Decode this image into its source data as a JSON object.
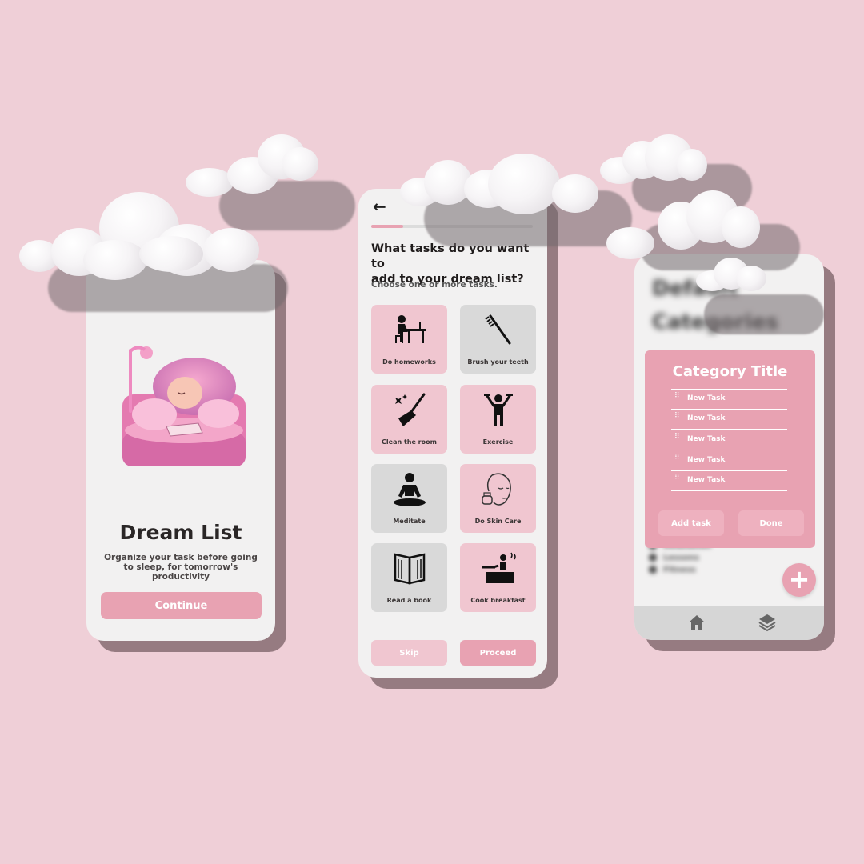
{
  "screen1": {
    "title": "Dream List",
    "subtitle_line1": "Organize your task before going",
    "subtitle_line2": "to sleep, for tomorrow's productivity",
    "continue_label": "Continue"
  },
  "screen2": {
    "back_icon": "arrow-left-icon",
    "progress": 0.2,
    "question_line1": "What tasks do you want to",
    "question_line2": "add to your dream list?",
    "hint": "Choose one or more tasks.",
    "tasks": [
      {
        "label": "Do homeworks",
        "icon": "homework-desk-icon",
        "selected": true
      },
      {
        "label": "Brush your teeth",
        "icon": "toothbrush-icon",
        "selected": false
      },
      {
        "label": "Clean the room",
        "icon": "broom-icon",
        "selected": true
      },
      {
        "label": "Exercise",
        "icon": "exercise-person-icon",
        "selected": true
      },
      {
        "label": "Meditate",
        "icon": "meditate-icon",
        "selected": false
      },
      {
        "label": "Do Skin Care",
        "icon": "skin-care-face-icon",
        "selected": true
      },
      {
        "label": "Read a book",
        "icon": "open-book-icon",
        "selected": false
      },
      {
        "label": "Cook breakfast",
        "icon": "cooking-icon",
        "selected": true
      }
    ],
    "skip_label": "Skip",
    "proceed_label": "Proceed",
    "colors": {
      "selected": "#f0c6d0",
      "unselected": "#d9d9d9",
      "accent": "#e8a2b2"
    }
  },
  "screen3": {
    "background_title_line1": "Default",
    "background_title_line2": "Categories",
    "background_list": [
      "Relaxation",
      "Lessons",
      "Fitness"
    ],
    "modal": {
      "title": "Category Title",
      "items": [
        "New Task",
        "New Task",
        "New Task",
        "New Task",
        "New Task"
      ],
      "add_task_label": "Add task",
      "done_label": "Done"
    },
    "fab_label": "+",
    "nav": [
      "home-icon",
      "layers-icon"
    ]
  }
}
